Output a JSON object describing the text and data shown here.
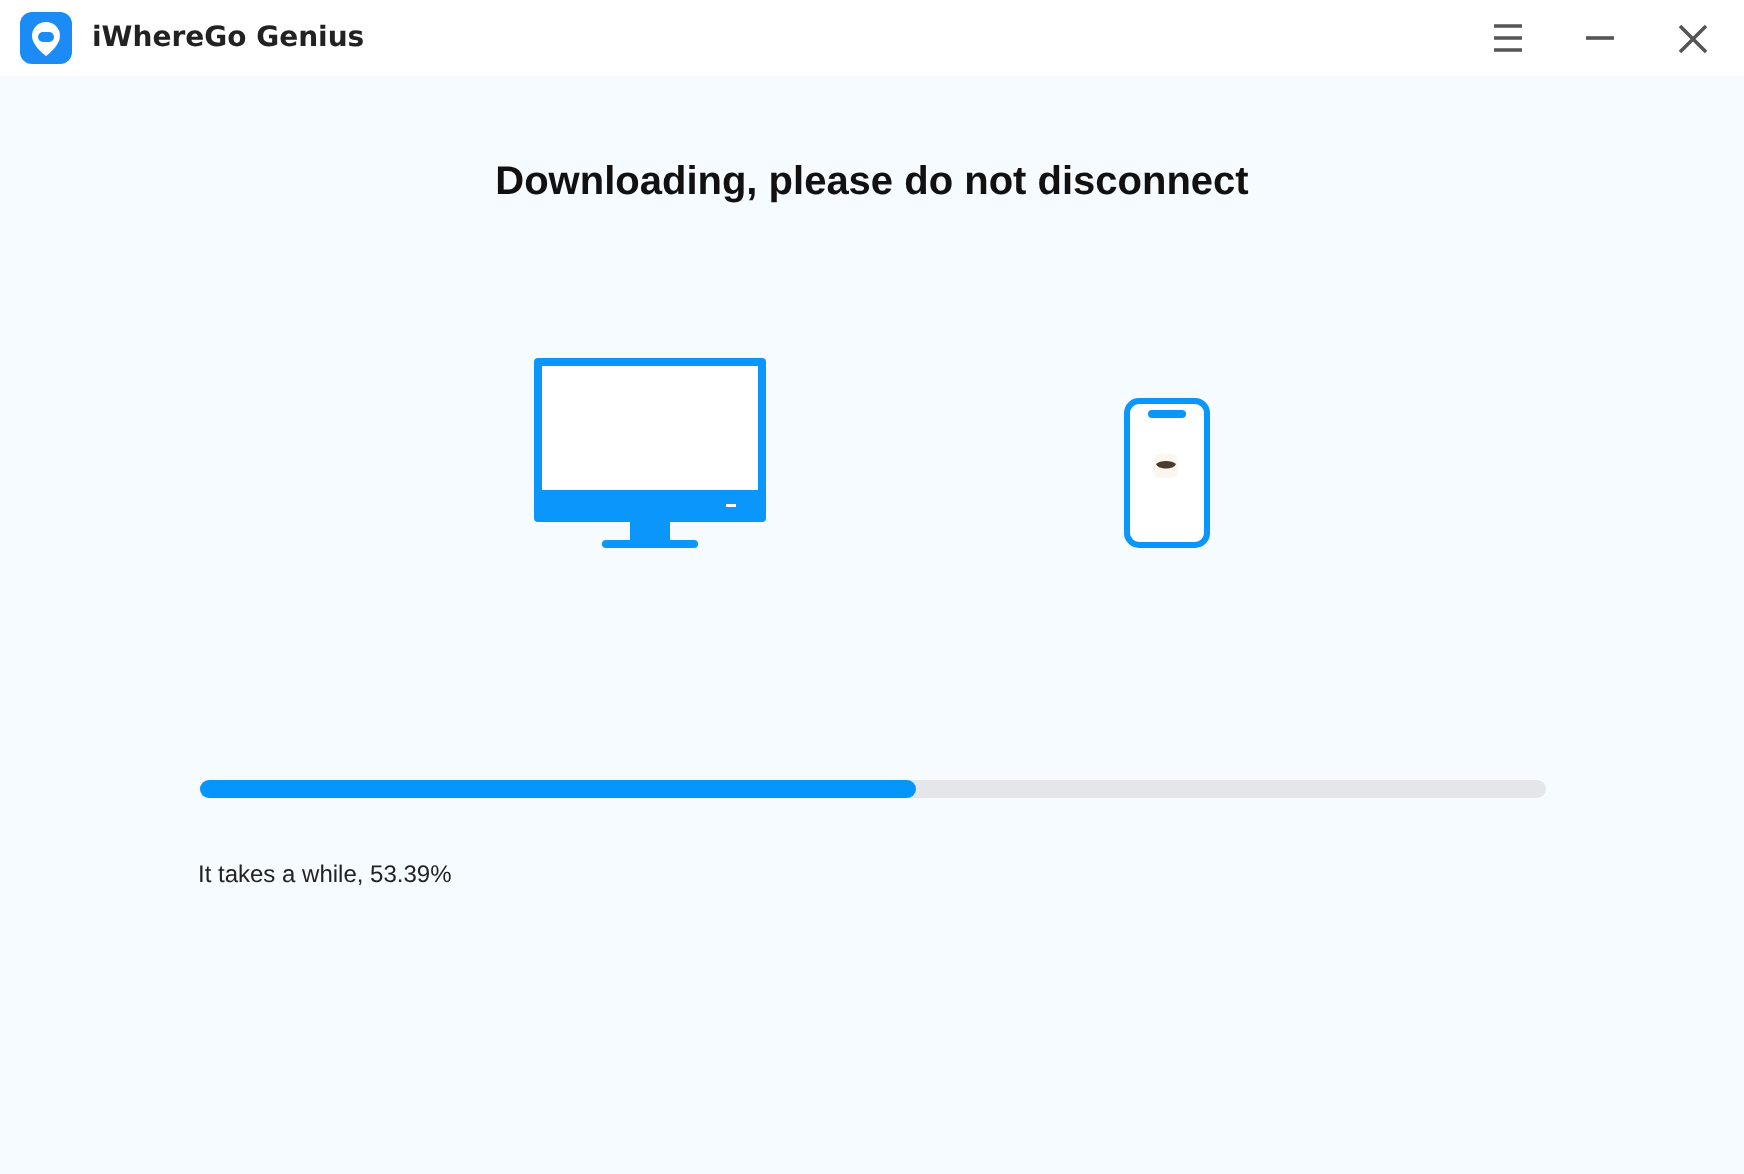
{
  "window": {
    "title": "iWhereGo Genius"
  },
  "heading": "Downloading, please do not disconnect",
  "progress": {
    "level": 0.533
  },
  "status": "It takes a while, 53.39%"
}
